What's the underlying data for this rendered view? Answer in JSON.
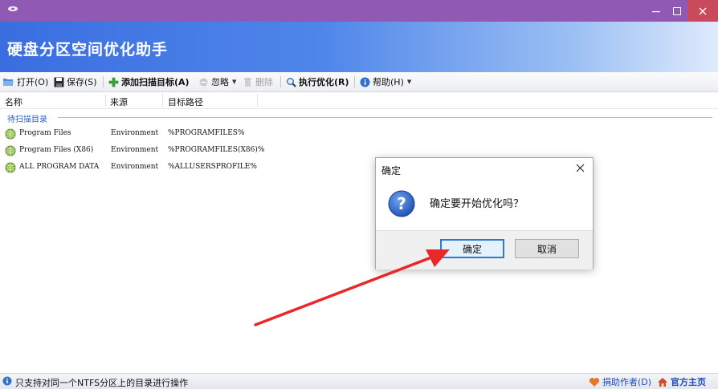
{
  "app": {
    "title": "硬盘分区空间优化助手"
  },
  "toolbar": {
    "open": "打开(O)",
    "save": "保存(S)",
    "add_target": "添加扫描目标(A)",
    "ignore": "忽略",
    "delete": "删除",
    "optimize": "执行优化(R)",
    "help": "帮助(H)"
  },
  "columns": [
    "名称",
    "来源",
    "目标路径"
  ],
  "group": {
    "label": "待扫描目录"
  },
  "rows": [
    {
      "name": "Program Files",
      "source": "Environment",
      "path": "%PROGRAMFILES%"
    },
    {
      "name": "Program Files (X86)",
      "source": "Environment",
      "path": "%PROGRAMFILES(X86)%"
    },
    {
      "name": "ALL PROGRAM DATA",
      "source": "Environment",
      "path": "%ALLUSERSPROFILE%"
    }
  ],
  "dialog": {
    "title": "确定",
    "message": "确定要开始优化吗？",
    "ok": "确定",
    "cancel": "取消"
  },
  "status": {
    "message": "只支持对同一个NTFS分区上的目录进行操作",
    "donate": "捐助作者(D)",
    "homepage": "官方主页"
  },
  "colors": {
    "titlebar": "#8f59b4",
    "banner": "#3a6ee0",
    "arrow": "#e8282a",
    "primary_button_border": "#2c78d8"
  }
}
